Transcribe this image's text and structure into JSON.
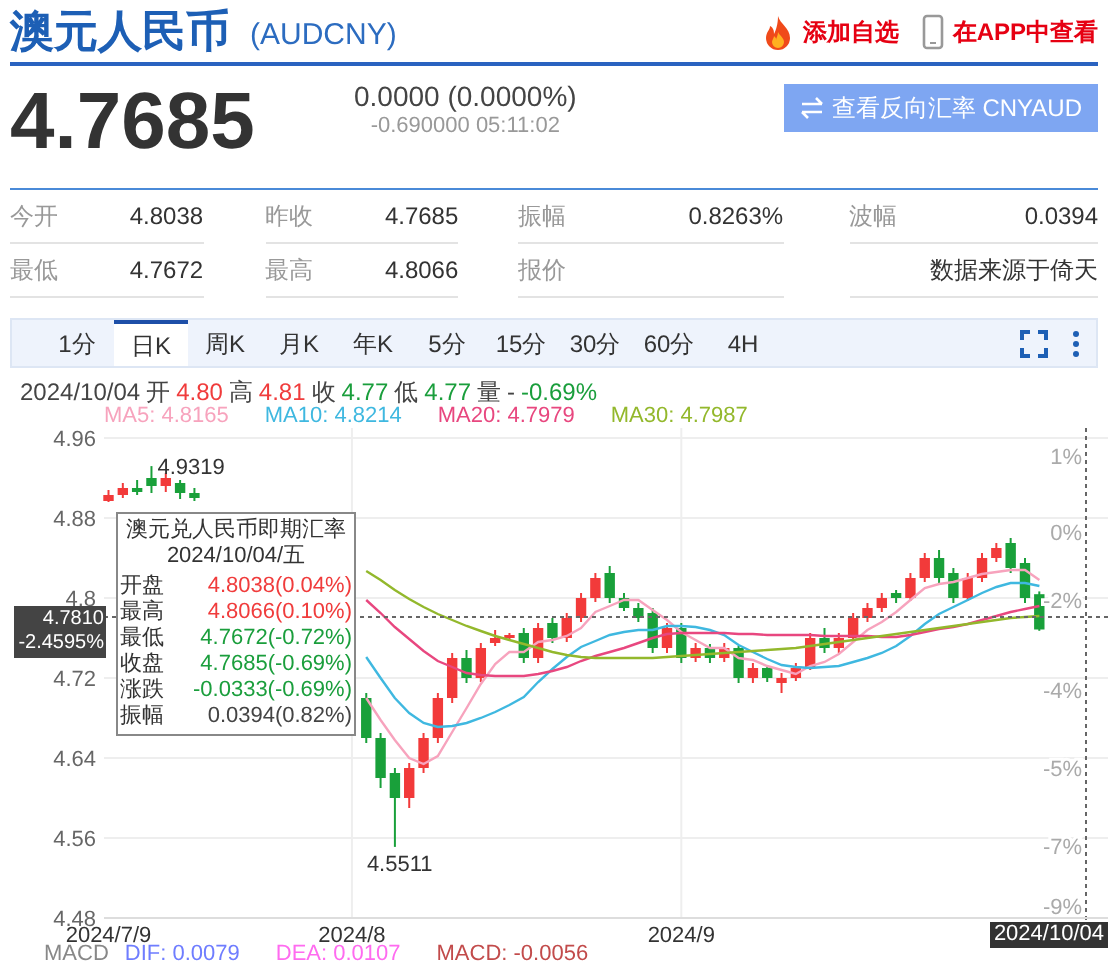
{
  "header": {
    "title": "澳元人民币",
    "code": "(AUDCNY)",
    "actions": [
      {
        "label": "添加自选",
        "kind": "fire"
      },
      {
        "label": "在APP中查看",
        "kind": "phone"
      }
    ]
  },
  "quote": {
    "price": "4.7685",
    "change": "0.0000 (0.0000%)",
    "detail": "-0.690000 05:11:02",
    "reverse_button": "查看反向汇率 CNYAUD"
  },
  "stats": [
    [
      {
        "label": "今开",
        "value": "4.8038"
      },
      {
        "label": "昨收",
        "value": "4.7685"
      },
      {
        "label": "振幅",
        "value": "0.8263%"
      },
      {
        "label": "波幅",
        "value": "0.0394"
      }
    ],
    [
      {
        "label": "最低",
        "value": "4.7672"
      },
      {
        "label": "最高",
        "value": "4.8066"
      },
      {
        "label": "报价"
      },
      {
        "value": "数据来源于倚天"
      }
    ]
  ],
  "tabs": [
    {
      "label": "1分",
      "selected": false
    },
    {
      "label": "日K",
      "selected": true
    },
    {
      "label": "周K",
      "selected": false
    },
    {
      "label": "月K",
      "selected": false
    },
    {
      "label": "年K",
      "selected": false
    },
    {
      "label": "5分",
      "selected": false
    },
    {
      "label": "15分",
      "selected": false
    },
    {
      "label": "30分",
      "selected": false
    },
    {
      "label": "60分",
      "selected": false
    },
    {
      "label": "4H",
      "selected": false
    }
  ],
  "info_line": {
    "date": "2024/10/04",
    "items": [
      {
        "label": "开",
        "value": "4.80",
        "color": "#f03c3c"
      },
      {
        "label": "高",
        "value": "4.81",
        "color": "#f03c3c"
      },
      {
        "label": "收",
        "value": "4.77",
        "color": "#1a9e3c"
      },
      {
        "label": "低",
        "value": "4.77",
        "color": "#1a9e3c"
      },
      {
        "label": "量",
        "value": "-",
        "color": "#444444"
      }
    ],
    "change": {
      "value": "-0.69%",
      "color": "#1a9e3c"
    }
  },
  "ma_legend": [
    {
      "label": "MA5: 4.8165",
      "color": "#f7a3bd"
    },
    {
      "label": "MA10: 4.8214",
      "color": "#3fb8e0"
    },
    {
      "label": "MA20: 4.7979",
      "color": "#e8477f"
    },
    {
      "label": "MA30: 4.7987",
      "color": "#93b82c"
    }
  ],
  "chart": {
    "chart_data": {
      "type": "candlestick",
      "categories": [
        "2024/7/9",
        null,
        null,
        null,
        null,
        null,
        null,
        null,
        null,
        null,
        null,
        null,
        null,
        null,
        null,
        null,
        null,
        "2024/8",
        null,
        null,
        null,
        null,
        null,
        null,
        null,
        null,
        null,
        null,
        null,
        null,
        null,
        null,
        null,
        null,
        null,
        null,
        null,
        null,
        null,
        null,
        "2024/9",
        null,
        null,
        null,
        null,
        null,
        null,
        null,
        null,
        null,
        null,
        null,
        null,
        null,
        null,
        null,
        null,
        null,
        null,
        null,
        null,
        null,
        null,
        null,
        null,
        null
      ],
      "ylim": [
        4.48,
        4.97
      ],
      "grid": true,
      "ref_lines": [
        {
          "axis": "y",
          "value": 4.781
        }
      ],
      "yticks": [
        4.96,
        4.88,
        4.8,
        4.72,
        4.64,
        4.56,
        4.48
      ],
      "ohlc": [
        [
          4.897,
          4.908,
          4.896,
          4.903
        ],
        [
          4.903,
          4.915,
          4.9,
          4.91
        ],
        [
          4.91,
          4.918,
          4.903,
          4.906
        ],
        [
          4.92,
          4.9319,
          4.905,
          4.912
        ],
        [
          4.912,
          4.925,
          4.906,
          4.92
        ],
        [
          4.915,
          4.918,
          4.899,
          4.905
        ],
        [
          4.905,
          4.91,
          4.897,
          4.9
        ],
        null,
        null,
        null,
        null,
        null,
        null,
        null,
        null,
        null,
        null,
        null,
        [
          4.7,
          4.705,
          4.655,
          4.66
        ],
        [
          4.66,
          4.665,
          4.61,
          4.62
        ],
        [
          4.625,
          4.63,
          4.5511,
          4.6
        ],
        [
          4.6,
          4.635,
          4.59,
          4.63
        ],
        [
          4.63,
          4.665,
          4.625,
          4.66
        ],
        [
          4.66,
          4.705,
          4.655,
          4.7
        ],
        [
          4.7,
          4.745,
          4.695,
          4.74
        ],
        [
          4.74,
          4.748,
          4.715,
          4.72
        ],
        [
          4.72,
          4.755,
          4.716,
          4.75
        ],
        [
          4.755,
          4.768,
          4.752,
          4.76
        ],
        [
          4.76,
          4.765,
          4.757,
          4.763
        ],
        [
          4.765,
          4.77,
          4.735,
          4.74
        ],
        [
          4.74,
          4.775,
          4.735,
          4.77
        ],
        [
          4.775,
          4.78,
          4.755,
          4.76
        ],
        [
          4.76,
          4.785,
          4.756,
          4.78
        ],
        [
          4.78,
          4.805,
          4.776,
          4.8
        ],
        [
          4.8,
          4.825,
          4.796,
          4.82
        ],
        [
          4.825,
          4.832,
          4.795,
          4.8
        ],
        [
          4.8,
          4.805,
          4.787,
          4.79
        ],
        [
          4.79,
          4.795,
          4.776,
          4.78
        ],
        [
          4.785,
          4.79,
          4.745,
          4.75
        ],
        [
          4.75,
          4.775,
          4.745,
          4.77
        ],
        [
          4.77,
          4.775,
          4.735,
          4.74
        ],
        [
          4.74,
          4.755,
          4.736,
          4.75
        ],
        [
          4.75,
          4.754,
          4.735,
          4.74
        ],
        [
          4.74,
          4.755,
          4.736,
          4.75
        ],
        [
          4.75,
          4.752,
          4.715,
          4.72
        ],
        [
          4.72,
          4.735,
          4.715,
          4.73
        ],
        [
          4.73,
          4.733,
          4.716,
          4.72
        ],
        [
          4.715,
          4.725,
          4.705,
          4.72
        ],
        [
          4.72,
          4.735,
          4.717,
          4.73
        ],
        [
          4.73,
          4.765,
          4.728,
          4.76
        ],
        [
          4.76,
          4.77,
          4.745,
          4.75
        ],
        [
          4.75,
          4.765,
          4.745,
          4.76
        ],
        [
          4.76,
          4.785,
          4.757,
          4.78
        ],
        [
          4.78,
          4.795,
          4.776,
          4.79
        ],
        [
          4.79,
          4.805,
          4.786,
          4.8
        ],
        [
          4.805,
          4.808,
          4.795,
          4.8
        ],
        [
          4.8,
          4.825,
          4.797,
          4.82
        ],
        [
          4.82,
          4.845,
          4.816,
          4.84
        ],
        [
          4.84,
          4.848,
          4.815,
          4.82
        ],
        [
          4.825,
          4.83,
          4.795,
          4.8
        ],
        [
          4.8,
          4.825,
          4.797,
          4.82
        ],
        [
          4.82,
          4.845,
          4.816,
          4.84
        ],
        [
          4.84,
          4.855,
          4.836,
          4.85
        ],
        [
          4.855,
          4.86,
          4.825,
          4.83
        ],
        [
          4.835,
          4.84,
          4.795,
          4.8
        ],
        [
          4.8038,
          4.8066,
          4.7672,
          4.7685
        ]
      ],
      "series": [
        {
          "type": "line",
          "color": "#f7a3bd",
          "values": [
            null,
            null,
            null,
            null,
            null,
            null,
            null,
            null,
            null,
            null,
            null,
            null,
            null,
            null,
            null,
            null,
            null,
            null,
            4.7,
            4.678,
            4.658,
            4.64,
            4.634,
            4.642,
            4.666,
            4.69,
            4.714,
            4.734,
            4.746,
            4.746,
            4.756,
            4.758,
            4.762,
            4.77,
            4.786,
            4.792,
            4.798,
            4.798,
            4.788,
            4.778,
            4.766,
            4.758,
            4.75,
            4.75,
            4.74,
            4.738,
            4.732,
            4.728,
            4.724,
            4.732,
            4.736,
            4.744,
            4.756,
            4.768,
            4.776,
            4.786,
            4.798,
            4.81,
            4.814,
            4.816,
            4.82,
            4.824,
            4.826,
            4.828,
            4.828,
            4.818
          ]
        },
        {
          "type": "line",
          "color": "#3fb8e0",
          "values": [
            null,
            null,
            null,
            null,
            null,
            null,
            null,
            null,
            null,
            null,
            null,
            null,
            null,
            null,
            null,
            null,
            null,
            null,
            4.741,
            4.72,
            4.7,
            4.685,
            4.675,
            4.671,
            4.672,
            4.675,
            4.68,
            4.686,
            4.693,
            4.701,
            4.716,
            4.729,
            4.741,
            4.751,
            4.757,
            4.763,
            4.766,
            4.768,
            4.768,
            4.772,
            4.772,
            4.771,
            4.768,
            4.763,
            4.753,
            4.746,
            4.739,
            4.733,
            4.731,
            4.73,
            4.731,
            4.732,
            4.736,
            4.74,
            4.745,
            4.752,
            4.762,
            4.774,
            4.784,
            4.791,
            4.798,
            4.805,
            4.811,
            4.815,
            4.815,
            4.812
          ]
        },
        {
          "type": "line",
          "color": "#e8477f",
          "values": [
            null,
            null,
            null,
            null,
            null,
            null,
            null,
            null,
            null,
            null,
            null,
            null,
            null,
            null,
            null,
            null,
            null,
            null,
            4.798,
            4.785,
            4.771,
            4.759,
            4.747,
            4.737,
            4.731,
            4.725,
            4.723,
            4.722,
            4.722,
            4.722,
            4.724,
            4.727,
            4.731,
            4.737,
            4.742,
            4.746,
            4.75,
            4.755,
            4.76,
            4.764,
            4.765,
            4.765,
            4.765,
            4.765,
            4.764,
            4.764,
            4.763,
            4.763,
            4.763,
            4.763,
            4.762,
            4.762,
            4.762,
            4.762,
            4.761,
            4.761,
            4.763,
            4.766,
            4.769,
            4.771,
            4.774,
            4.778,
            4.782,
            4.786,
            4.789,
            4.792
          ]
        },
        {
          "type": "line",
          "color": "#93b82c",
          "values": [
            null,
            null,
            null,
            null,
            null,
            null,
            null,
            null,
            null,
            null,
            null,
            null,
            null,
            null,
            null,
            null,
            null,
            null,
            4.827,
            4.818,
            4.808,
            4.799,
            4.791,
            4.784,
            4.778,
            4.772,
            4.767,
            4.762,
            4.758,
            4.754,
            4.75,
            4.746,
            4.743,
            4.741,
            4.74,
            4.74,
            4.74,
            4.74,
            4.74,
            4.741,
            4.742,
            4.743,
            4.744,
            4.745,
            4.746,
            4.747,
            4.748,
            4.749,
            4.75,
            4.752,
            4.754,
            4.756,
            4.758,
            4.76,
            4.762,
            4.764,
            4.766,
            4.768,
            4.77,
            4.772,
            4.774,
            4.776,
            4.778,
            4.78,
            4.781,
            4.782
          ]
        }
      ]
    },
    "pct_labels": [
      "1%",
      "0%",
      "-2%",
      "-4%",
      "-5%",
      "-7%",
      "-9%"
    ],
    "high_label": "4.9319",
    "low_label": "4.5511",
    "cursor_price": "4.7810",
    "cursor_pct": "-2.4595%",
    "cursor_date": "2024/10/04"
  },
  "tooltip": {
    "title": "澳元兑人民币即期汇率",
    "date": "2024/10/04/五",
    "rows": [
      {
        "label": "开盘",
        "value": "4.8038(0.04%)",
        "color": "#f03c3c"
      },
      {
        "label": "最高",
        "value": "4.8066(0.10%)",
        "color": "#f03c3c"
      },
      {
        "label": "最低",
        "value": "4.7672(-0.72%)",
        "color": "#1a9e3c"
      },
      {
        "label": "收盘",
        "value": "4.7685(-0.69%)",
        "color": "#1a9e3c"
      },
      {
        "label": "涨跌",
        "value": "-0.0333(-0.69%)",
        "color": "#1a9e3c"
      },
      {
        "label": "振幅",
        "value": "0.0394(0.82%)",
        "color": "#444444"
      }
    ]
  },
  "macd": {
    "label": "MACD",
    "items": [
      {
        "label": "DIF: 0.0079",
        "color": "#6f7dff"
      },
      {
        "label": "DEA: 0.0107",
        "color": "#ff6bf0"
      },
      {
        "label": "MACD: -0.0056",
        "color": "#c24b4b"
      }
    ]
  }
}
